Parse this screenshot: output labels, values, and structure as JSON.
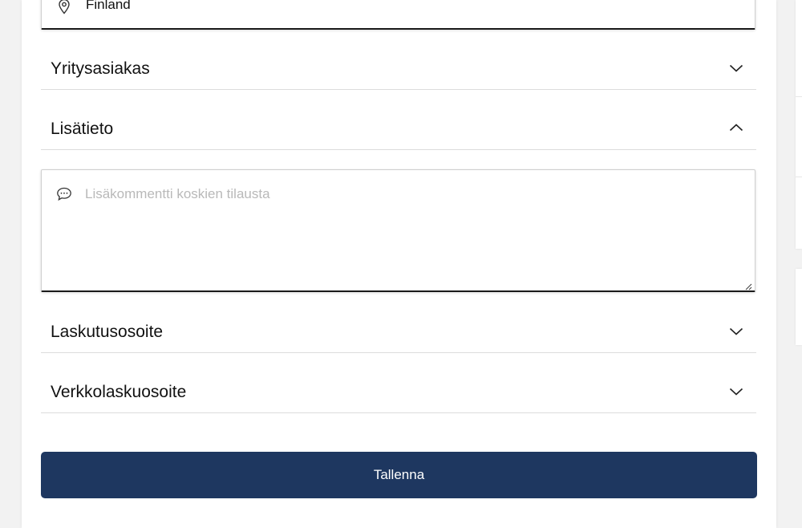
{
  "address": {
    "country_value": "Finland",
    "country_icon": "location-pin-icon"
  },
  "sections": {
    "business_customer": {
      "label": "Yritysasiakas",
      "state": "collapsed"
    },
    "additional_info": {
      "label": "Lisätieto",
      "state": "expanded"
    },
    "billing_address": {
      "label": "Laskutusosoite",
      "state": "collapsed"
    },
    "e_invoice_address": {
      "label": "Verkkolaskuosoite",
      "state": "collapsed"
    }
  },
  "comment": {
    "placeholder": "Lisäkommentti koskien tilausta",
    "value": "",
    "icon": "speech-bubble-icon"
  },
  "actions": {
    "save_label": "Tallenna"
  },
  "colors": {
    "primary_button": "#1e3760",
    "placeholder": "#b9b9b9",
    "divider": "#dcdcdc"
  }
}
